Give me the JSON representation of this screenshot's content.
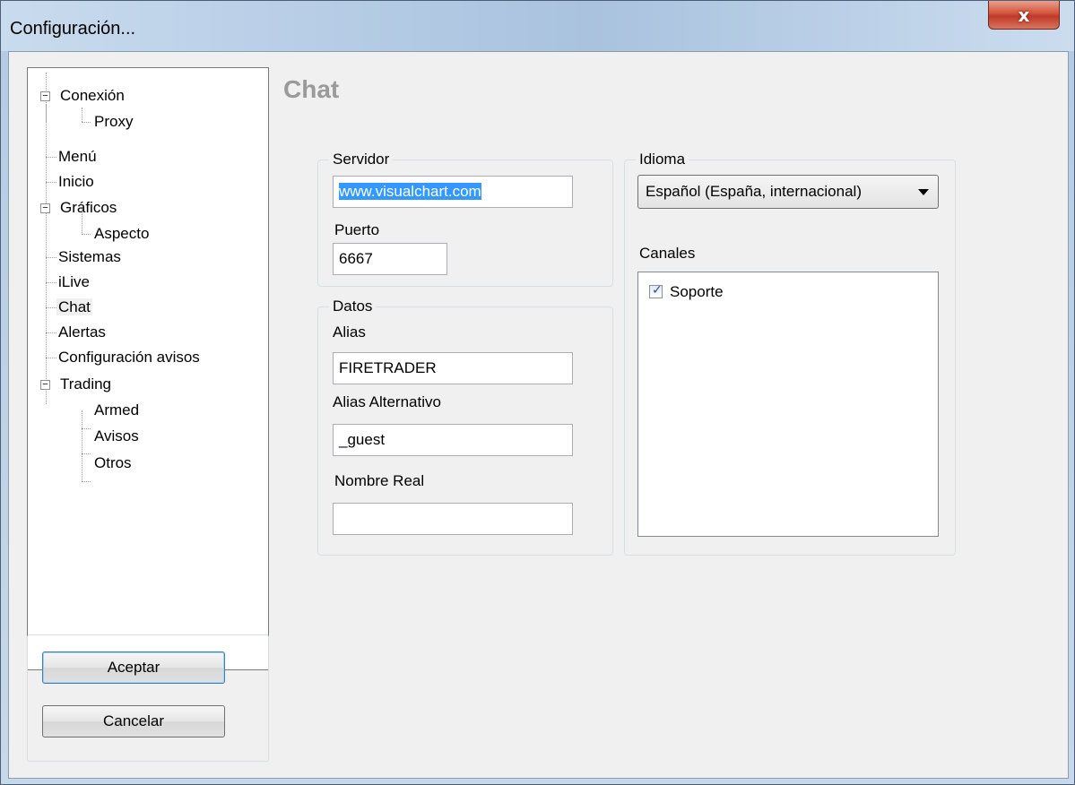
{
  "window": {
    "title": "Configuración...",
    "close_glyph": "x"
  },
  "tree": {
    "items": [
      {
        "label": "Conexión",
        "expander": "−"
      },
      {
        "label": "Proxy"
      },
      {
        "label": "Menú"
      },
      {
        "label": "Inicio"
      },
      {
        "label": "Gráficos",
        "expander": "−"
      },
      {
        "label": "Aspecto"
      },
      {
        "label": "Sistemas"
      },
      {
        "label": "iLive"
      },
      {
        "label": "Chat",
        "selected": true
      },
      {
        "label": "Alertas"
      },
      {
        "label": "Configuración avisos"
      },
      {
        "label": "Trading",
        "expander": "−"
      },
      {
        "label": "Armed"
      },
      {
        "label": "Avisos"
      },
      {
        "label": "Otros"
      }
    ]
  },
  "buttons": {
    "accept": "Aceptar",
    "cancel": "Cancelar"
  },
  "page": {
    "title": "Chat"
  },
  "servidor": {
    "legend": "Servidor",
    "host_value": "www.visualchart.com",
    "port_label": "Puerto",
    "port_value": "6667"
  },
  "datos": {
    "legend": "Datos",
    "alias_label": "Alias",
    "alias_value": "FIRETRADER",
    "alt_alias_label": "Alias Alternativo",
    "alt_alias_value": "_guest",
    "real_name_label": "Nombre Real",
    "real_name_value": ""
  },
  "idioma": {
    "legend": "Idioma",
    "selected": "Español (España, internacional)",
    "channels_label": "Canales",
    "channels": [
      {
        "label": "Soporte",
        "checked": true
      }
    ]
  }
}
